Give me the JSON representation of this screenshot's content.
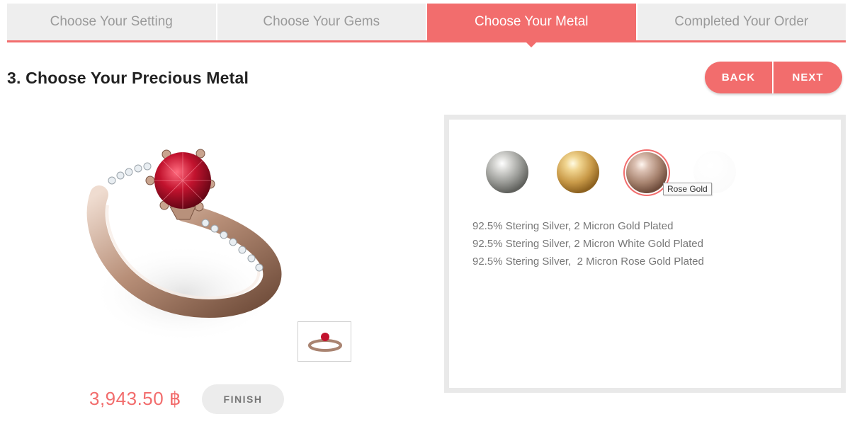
{
  "steps": [
    {
      "label": "Choose Your Setting",
      "active": false
    },
    {
      "label": "Choose Your Gems",
      "active": false
    },
    {
      "label": "Choose Your Metal",
      "active": true
    },
    {
      "label": "Completed Your Order",
      "active": false
    }
  ],
  "page": {
    "title": "3. Choose Your Precious Metal"
  },
  "nav": {
    "back_label": "BACK",
    "next_label": "NEXT"
  },
  "product": {
    "price": "3,943.50 ฿",
    "finish_label": "FINISH"
  },
  "metals": {
    "swatches": [
      {
        "name": "silver-swatch",
        "color": "#b8b9b5"
      },
      {
        "name": "gold-swatch",
        "color": "#e2c27a"
      },
      {
        "name": "rose-gold-swatch",
        "color": "#c0a292",
        "selected": true
      }
    ],
    "tooltip": "Rose Gold",
    "descriptions": [
      "92.5% Stering Silver, 2 Micron Gold Plated",
      "92.5% Stering Silver, 2 Micron White Gold Plated",
      "92.5% Stering Silver,  2 Micron Rose Gold Plated"
    ]
  },
  "colors": {
    "accent": "#f26d6d",
    "tab_inactive": "#eeeeee",
    "panel_border": "#e9e9e9"
  }
}
